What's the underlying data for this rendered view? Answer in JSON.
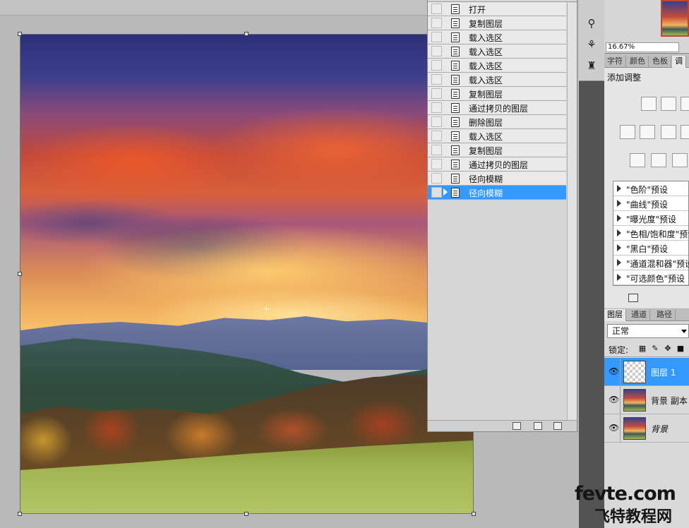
{
  "history": {
    "items": [
      {
        "label": "打开"
      },
      {
        "label": "复制图层"
      },
      {
        "label": "载入选区"
      },
      {
        "label": "载入选区"
      },
      {
        "label": "载入选区"
      },
      {
        "label": "载入选区"
      },
      {
        "label": "复制图层"
      },
      {
        "label": "通过拷贝的图层"
      },
      {
        "label": "删除图层"
      },
      {
        "label": "载入选区"
      },
      {
        "label": "复制图层"
      },
      {
        "label": "通过拷贝的图层"
      },
      {
        "label": "径向模糊"
      },
      {
        "label": "径向模糊"
      }
    ],
    "selected_index": 13
  },
  "navigator": {
    "zoom": "16.67%"
  },
  "top_tabs": [
    {
      "label": "字符"
    },
    {
      "label": "颜色"
    },
    {
      "label": "色板"
    },
    {
      "label": "调"
    }
  ],
  "adjustments": {
    "title": "添加调整",
    "presets": [
      {
        "label": "\"色阶\"预设"
      },
      {
        "label": "\"曲线\"预设"
      },
      {
        "label": "\"曝光度\"预设"
      },
      {
        "label": "\"色相/饱和度\"预设"
      },
      {
        "label": "\"黑白\"预设"
      },
      {
        "label": "\"通道混和器\"预设"
      },
      {
        "label": "\"可选颜色\"预设"
      }
    ]
  },
  "layers_tabs": [
    {
      "label": "图层"
    },
    {
      "label": "通道"
    },
    {
      "label": "路径"
    }
  ],
  "layers": {
    "blend_mode": "正常",
    "lock_label": "锁定:",
    "items": [
      {
        "name": "图层 1"
      },
      {
        "name": "背景 副本"
      },
      {
        "name": "背景"
      }
    ]
  },
  "watermark": {
    "top": "fevte.com",
    "bottom": "飞特教程网"
  },
  "colors": {
    "selection": "#3399ff",
    "panel": "#d6d6d6",
    "toolstrip": "#535353"
  }
}
